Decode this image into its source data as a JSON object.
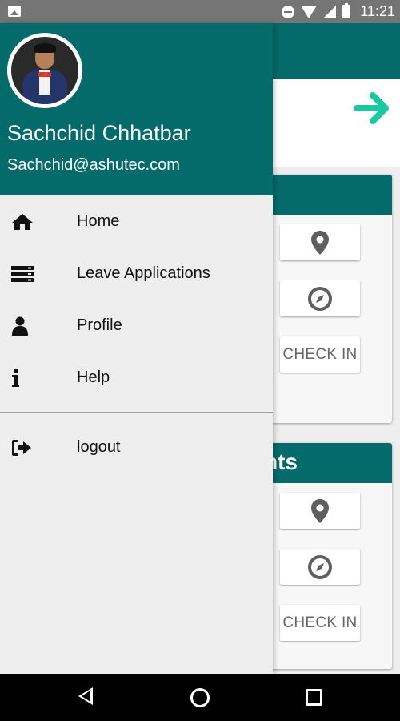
{
  "status_bar": {
    "time": "11:21"
  },
  "background": {
    "card_2_title_fragment": "nts",
    "buttons": {
      "check_in": "CHECK IN"
    }
  },
  "drawer": {
    "user_name": "Sachchid Chhatbar",
    "user_email": "Sachchid@ashutec.com",
    "menu": [
      {
        "label": "Home",
        "icon": "home-icon"
      },
      {
        "label": "Leave Applications",
        "icon": "list-icon"
      },
      {
        "label": "Profile",
        "icon": "user-icon"
      },
      {
        "label": "Help",
        "icon": "info-icon"
      }
    ],
    "logout": {
      "label": "logout",
      "icon": "sign-out-icon"
    }
  },
  "colors": {
    "primary": "#046a6a",
    "accent": "#1cc8a4",
    "drawer_bg": "#eeeeee"
  }
}
